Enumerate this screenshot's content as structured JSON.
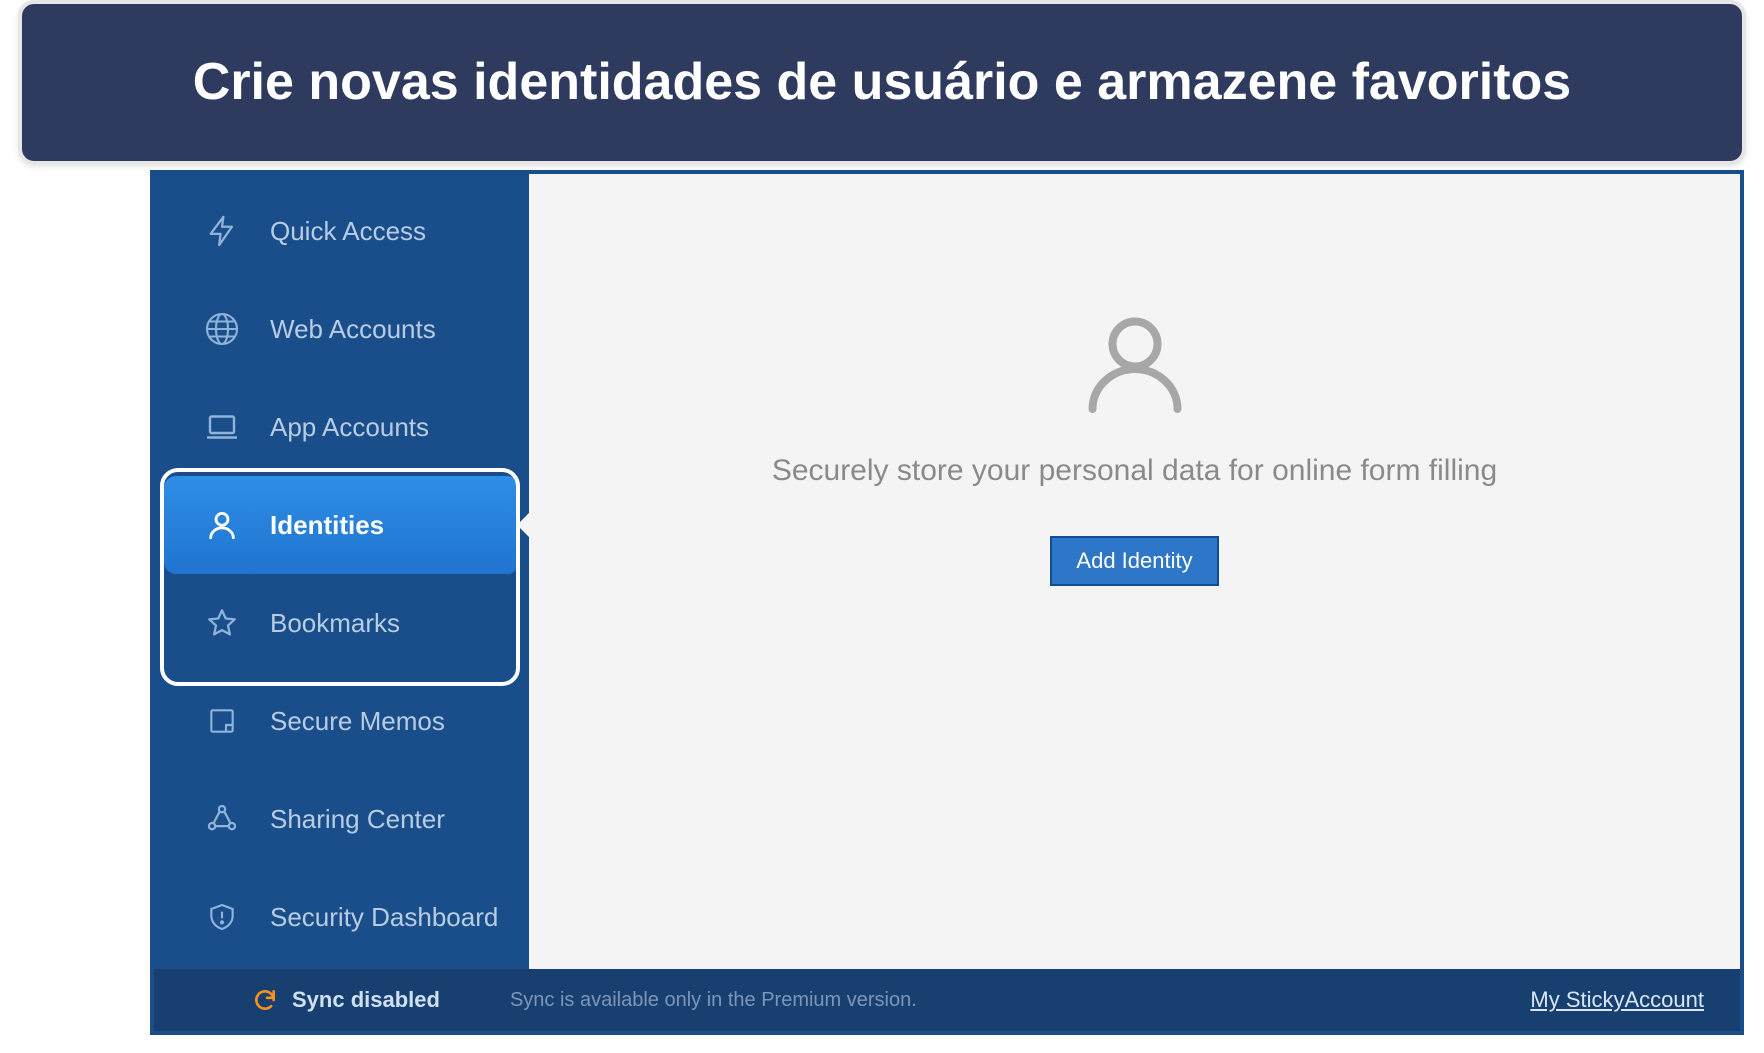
{
  "banner": {
    "text": "Crie novas identidades de usuário e armazene favoritos"
  },
  "sidebar": {
    "items": [
      {
        "icon": "bolt-icon",
        "label": "Quick Access"
      },
      {
        "icon": "globe-icon",
        "label": "Web Accounts"
      },
      {
        "icon": "laptop-icon",
        "label": "App Accounts"
      },
      {
        "icon": "person-icon",
        "label": "Identities",
        "active": true
      },
      {
        "icon": "star-icon",
        "label": "Bookmarks"
      },
      {
        "icon": "memo-icon",
        "label": "Secure Memos"
      },
      {
        "icon": "share-icon",
        "label": "Sharing Center"
      },
      {
        "icon": "shield-icon",
        "label": "Security Dashboard"
      }
    ]
  },
  "content": {
    "empty_message": "Securely store your personal data for online form filling",
    "add_button": "Add Identity"
  },
  "statusbar": {
    "sync_label": "Sync disabled",
    "sync_note": "Sync is available only in the Premium version.",
    "account_link": "My StickyAccount"
  }
}
